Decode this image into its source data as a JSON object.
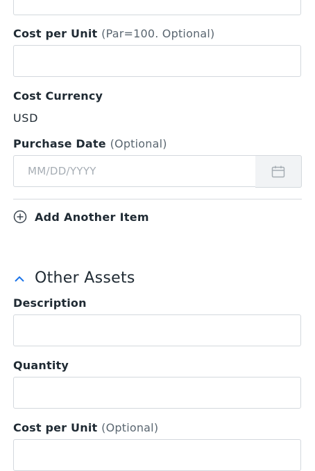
{
  "fields": {
    "cost_per_unit_label": "Cost per Unit",
    "cost_per_unit_hint": "(Par=100. Optional)",
    "cost_currency_label": "Cost Currency",
    "cost_currency_value": "USD",
    "purchase_date_label": "Purchase Date",
    "purchase_date_hint": "(Optional)",
    "purchase_date_placeholder": "MM/DD/YYYY"
  },
  "add_item": {
    "label": "Add Another Item",
    "icon": "plus-circle-icon"
  },
  "other_assets": {
    "title": "Other Assets",
    "toggle_icon": "chevron-up-icon",
    "description_label": "Description",
    "quantity_label": "Quantity",
    "cost_per_unit_label": "Cost per Unit",
    "cost_per_unit_hint": "(Optional)"
  },
  "colors": {
    "accent": "#1a73e8",
    "border": "#d3d8dd",
    "text": "#1f2a33"
  }
}
